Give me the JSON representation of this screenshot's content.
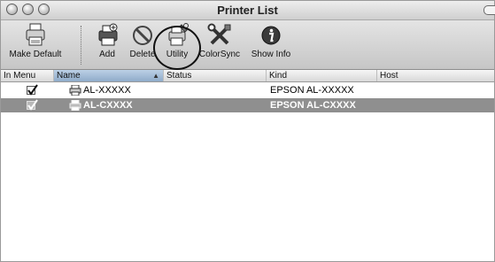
{
  "window": {
    "title": "Printer List"
  },
  "toolbar": {
    "make_default": "Make Default",
    "add": "Add",
    "delete": "Delete",
    "utility": "Utility",
    "colorsync": "ColorSync",
    "show_info": "Show Info"
  },
  "table": {
    "columns": [
      "In Menu",
      "Name",
      "Status",
      "Kind",
      "Host"
    ],
    "sort_indicator": "▲",
    "rows": [
      {
        "in_menu": true,
        "name": "AL-XXXXX",
        "status": "",
        "kind": "EPSON AL-XXXXX",
        "host": "",
        "selected": false
      },
      {
        "in_menu": true,
        "name": "AL-CXXXX",
        "status": "",
        "kind": "EPSON AL-CXXXX",
        "host": "",
        "selected": true
      }
    ]
  },
  "icons": {
    "make_default": "printer-default-icon",
    "add": "printer-add-icon",
    "delete": "no-entry-icon",
    "utility": "printer-utility-icon",
    "colorsync": "colorsync-tools-icon",
    "show_info": "info-icon"
  },
  "colors": {
    "selected_row": "#8f8f8f",
    "sorted_column": "#a9bfd8"
  }
}
